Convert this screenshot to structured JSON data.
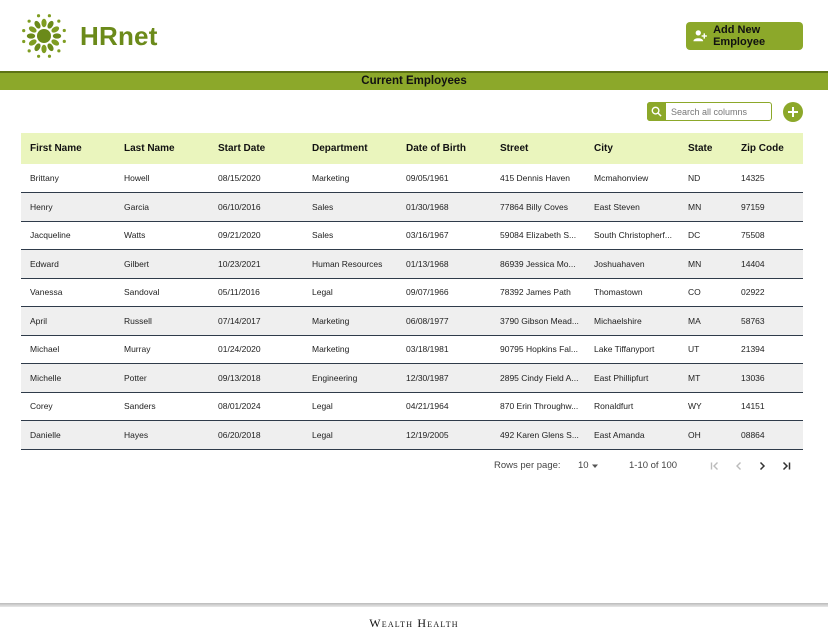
{
  "app": {
    "brand": "HRnet"
  },
  "header": {
    "add_button_label": "Add New Employee"
  },
  "section": {
    "title": "Current Employees"
  },
  "search": {
    "placeholder": "Search all columns",
    "value": ""
  },
  "table": {
    "columns": [
      "First Name",
      "Last Name",
      "Start Date",
      "Department",
      "Date of Birth",
      "Street",
      "City",
      "State",
      "Zip Code"
    ],
    "rows": [
      [
        "Brittany",
        "Howell",
        "08/15/2020",
        "Marketing",
        "09/05/1961",
        "415 Dennis Haven",
        "Mcmahonview",
        "ND",
        "14325"
      ],
      [
        "Henry",
        "Garcia",
        "06/10/2016",
        "Sales",
        "01/30/1968",
        "77864 Billy Coves",
        "East Steven",
        "MN",
        "97159"
      ],
      [
        "Jacqueline",
        "Watts",
        "09/21/2020",
        "Sales",
        "03/16/1967",
        "59084 Elizabeth S...",
        "South Christopherf...",
        "DC",
        "75508"
      ],
      [
        "Edward",
        "Gilbert",
        "10/23/2021",
        "Human Resources",
        "01/13/1968",
        "86939 Jessica Mo...",
        "Joshuahaven",
        "MN",
        "14404"
      ],
      [
        "Vanessa",
        "Sandoval",
        "05/11/2016",
        "Legal",
        "09/07/1966",
        "78392 James Path",
        "Thomastown",
        "CO",
        "02922"
      ],
      [
        "April",
        "Russell",
        "07/14/2017",
        "Marketing",
        "06/08/1977",
        "3790 Gibson Mead...",
        "Michaelshire",
        "MA",
        "58763"
      ],
      [
        "Michael",
        "Murray",
        "01/24/2020",
        "Marketing",
        "03/18/1981",
        "90795 Hopkins Fal...",
        "Lake Tiffanyport",
        "UT",
        "21394"
      ],
      [
        "Michelle",
        "Potter",
        "09/13/2018",
        "Engineering",
        "12/30/1987",
        "2895 Cindy Field A...",
        "East Phillipfurt",
        "MT",
        "13036"
      ],
      [
        "Corey",
        "Sanders",
        "08/01/2024",
        "Legal",
        "04/21/1964",
        "870 Erin Throughw...",
        "Ronaldfurt",
        "WY",
        "14151"
      ],
      [
        "Danielle",
        "Hayes",
        "06/20/2018",
        "Legal",
        "12/19/2005",
        "492 Karen Glens S...",
        "East Amanda",
        "OH",
        "08864"
      ]
    ]
  },
  "pagination": {
    "rows_per_page_label": "Rows per page:",
    "rows_per_page_value": "10",
    "range_text": "1-10 of 100"
  },
  "footer": {
    "text": "Wealth Health"
  },
  "colors": {
    "accent": "#8ca82a",
    "brand_text": "#6b8a1a",
    "header_row": "#eaf5bd"
  },
  "icons": {
    "logo": "flower-logo-icon",
    "add_user": "add-user-icon",
    "search": "search-icon",
    "plus": "plus-circle-icon",
    "first_page": "first-page-icon",
    "prev_page": "chevron-left-icon",
    "next_page": "chevron-right-icon",
    "last_page": "last-page-icon",
    "dropdown": "caret-down-icon"
  }
}
